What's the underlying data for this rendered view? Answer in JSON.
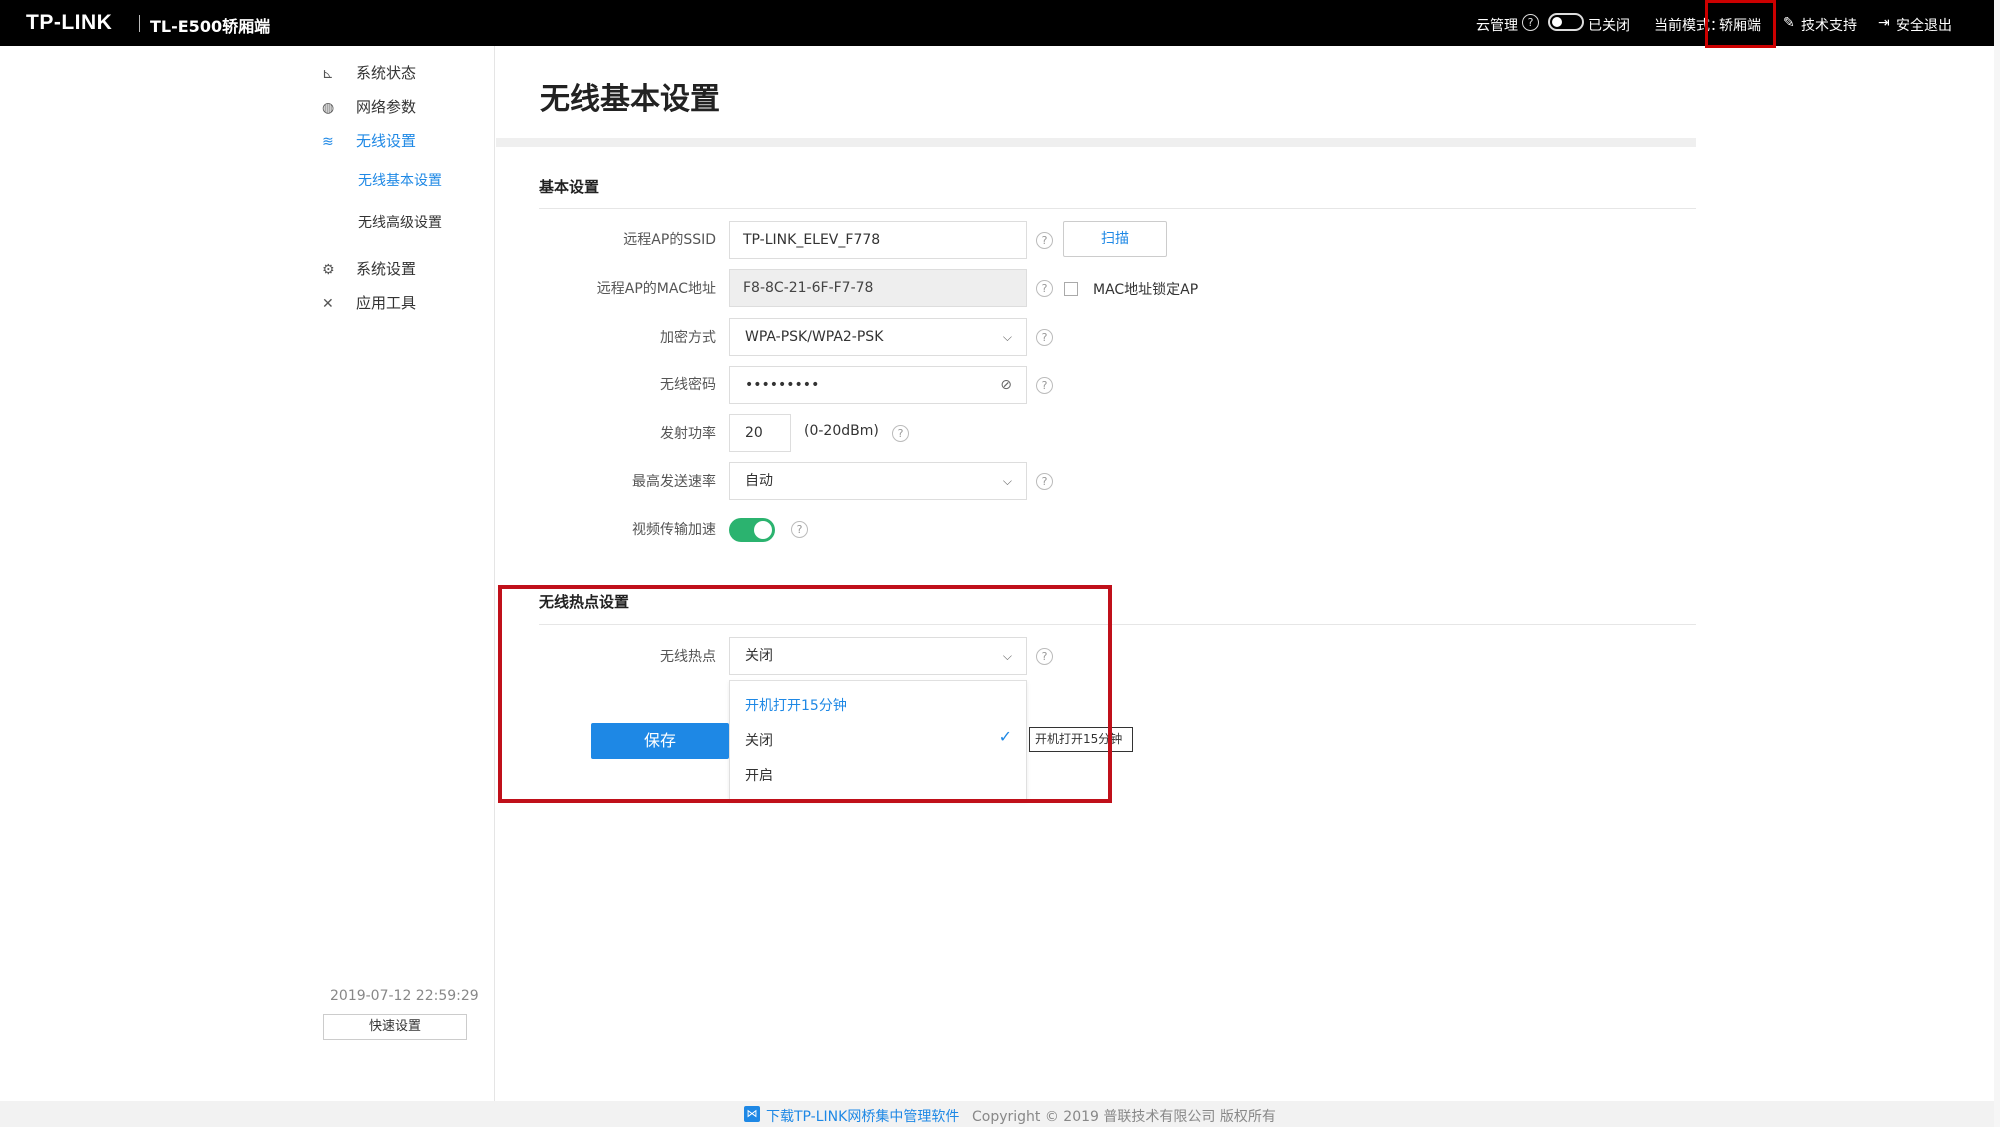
{
  "topbar": {
    "brand": "TP-LINK",
    "model": "TL-E500轿厢端",
    "cloud_label": "云管理",
    "cloud_state": "已关闭",
    "mode_label": "当前模式：",
    "mode_value": "轿厢端",
    "support": "技术支持",
    "logout": "安全退出"
  },
  "sidebar": {
    "items": [
      {
        "label": "系统状态",
        "icon": "chart-icon"
      },
      {
        "label": "网络参数",
        "icon": "globe-icon"
      },
      {
        "label": "无线设置",
        "icon": "wifi-icon"
      },
      {
        "label": "系统设置",
        "icon": "gear-icon"
      },
      {
        "label": "应用工具",
        "icon": "tools-icon"
      }
    ],
    "subitems": [
      "无线基本设置",
      "无线高级设置"
    ],
    "datetime": "2019-07-12 22:59:29",
    "quick_setup": "快速设置"
  },
  "main": {
    "title": "无线基本设置",
    "basic": {
      "title": "基本设置",
      "ssid_label": "远程AP的SSID",
      "ssid_value": "TP-LINK_ELEV_F778",
      "scan": "扫描",
      "mac_label": "远程AP的MAC地址",
      "mac_value": "F8-8C-21-6F-F7-78",
      "mac_lock": "MAC地址锁定AP",
      "enc_label": "加密方式",
      "enc_value": "WPA-PSK/WPA2-PSK",
      "pwd_label": "无线密码",
      "pwd_value": "•••••••••",
      "power_label": "发射功率",
      "power_value": "20",
      "power_unit": "(0-20dBm)",
      "rate_label": "最高发送速率",
      "rate_value": "自动",
      "video_label": "视频传输加速"
    },
    "hotspot": {
      "title": "无线热点设置",
      "label": "无线热点",
      "value": "关闭",
      "options": [
        "开机打开15分钟",
        "关闭",
        "开启"
      ],
      "tooltip": "开机打开15分钟"
    },
    "save": "保存"
  },
  "footer": {
    "download": "下载TP-LINK网桥集中管理软件",
    "copyright": "Copyright © 2019 普联技术有限公司 版权所有"
  }
}
